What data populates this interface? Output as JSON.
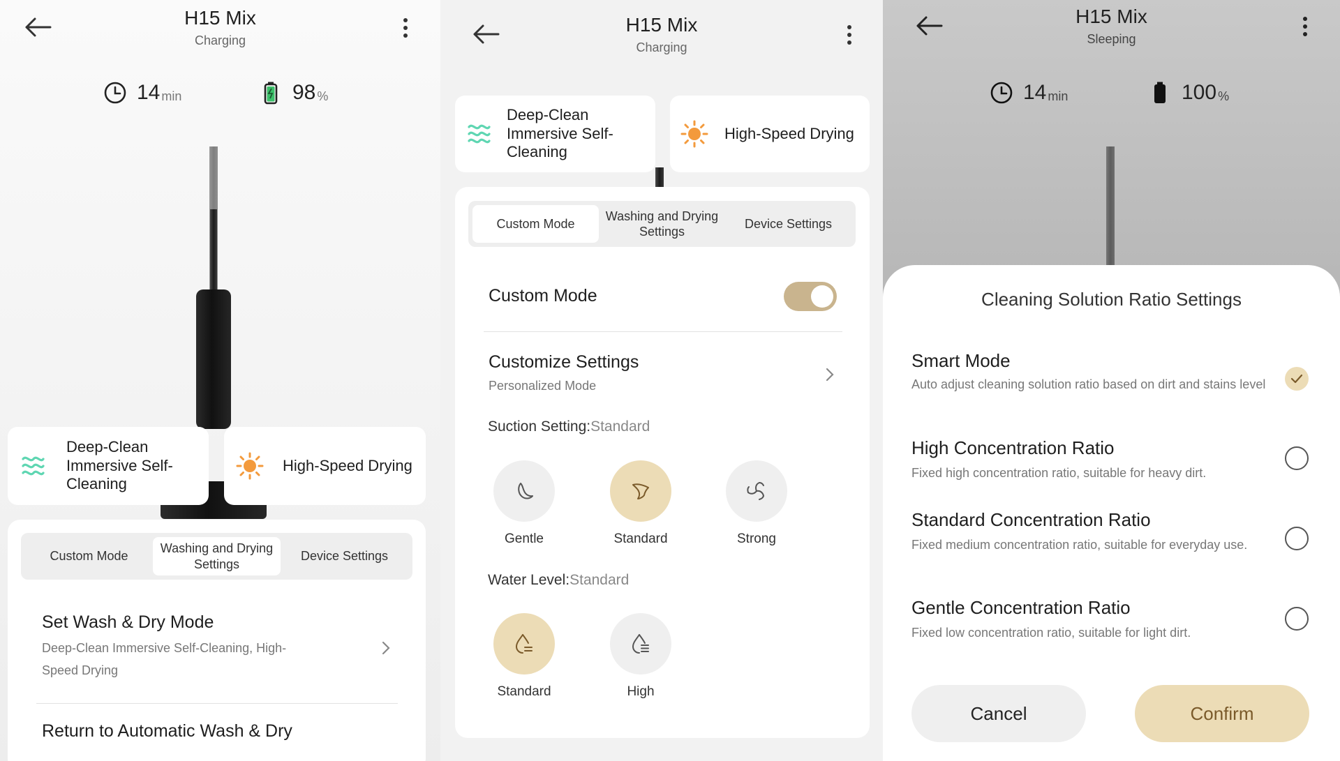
{
  "colors": {
    "accent": "#c9b48e",
    "accent_light": "#ecdcb6",
    "wash_icon": "#5fd6b2",
    "sun_icon": "#f39a3c",
    "battery_green": "#3cc06a"
  },
  "panel1": {
    "title": "H15 Mix",
    "status": "Charging",
    "time_value": "14",
    "time_unit": "min",
    "battery_value": "98",
    "battery_unit": "%",
    "cards": [
      {
        "icon": "wash-waves-icon",
        "label": "Deep-Clean Immersive Self-Cleaning"
      },
      {
        "icon": "sun-icon",
        "label": "High-Speed Drying"
      }
    ],
    "tabs": [
      "Custom Mode",
      "Washing and Drying Settings",
      "Device Settings"
    ],
    "active_tab": 1,
    "set_mode_title": "Set Wash & Dry Mode",
    "set_mode_sub": "Deep-Clean Immersive Self-Cleaning, High-Speed Drying",
    "return_title": "Return to Automatic Wash & Dry"
  },
  "panel2": {
    "title": "H15 Mix",
    "status": "Charging",
    "cards": [
      {
        "icon": "wash-waves-icon",
        "label": "Deep-Clean Immersive Self-Cleaning"
      },
      {
        "icon": "sun-icon",
        "label": "High-Speed Drying"
      }
    ],
    "tabs": [
      "Custom Mode",
      "Washing and Drying Settings",
      "Device Settings"
    ],
    "active_tab": 0,
    "custom_mode_label": "Custom Mode",
    "custom_mode_on": true,
    "customize_title": "Customize Settings",
    "customize_sub": "Personalized Mode",
    "suction_label": "Suction Setting:",
    "suction_value": "Standard",
    "suction_options": [
      "Gentle",
      "Standard",
      "Strong"
    ],
    "water_label": "Water Level:",
    "water_value": "Standard",
    "water_options": [
      "Standard",
      "High"
    ]
  },
  "panel3": {
    "title": "H15 Mix",
    "status": "Sleeping",
    "time_value": "14",
    "time_unit": "min",
    "battery_value": "100",
    "battery_unit": "%",
    "modal_title": "Cleaning Solution Ratio Settings",
    "options": [
      {
        "title": "Smart Mode",
        "desc": "Auto adjust cleaning solution ratio based on dirt and stains level",
        "checked": true
      },
      {
        "title": "High Concentration Ratio",
        "desc": "Fixed high concentration ratio, suitable  for heavy dirt.",
        "checked": false
      },
      {
        "title": "Standard Concentration Ratio",
        "desc": "Fixed medium concentration ratio, suitable  for everyday use.",
        "checked": false
      },
      {
        "title": "Gentle Concentration Ratio",
        "desc": "Fixed low concentration ratio, suitable for light dirt.",
        "checked": false
      }
    ],
    "cancel_label": "Cancel",
    "confirm_label": "Confirm"
  }
}
